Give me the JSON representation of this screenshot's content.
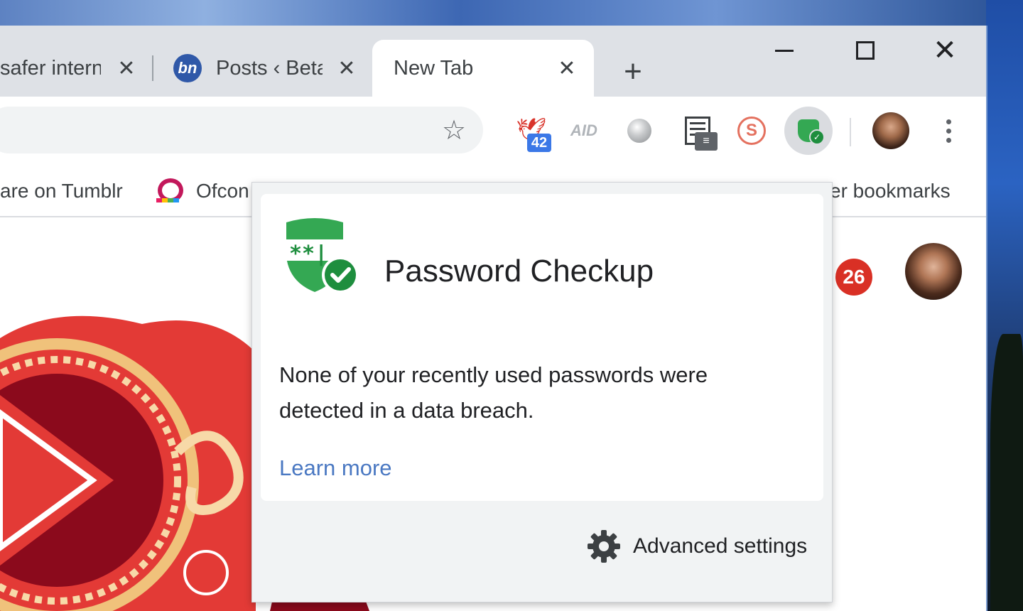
{
  "tabs": [
    {
      "title": "safer intern",
      "close": "✕"
    },
    {
      "title": "Posts ‹ Beta",
      "favicon_text": "bn",
      "close": "✕"
    },
    {
      "title": "New Tab",
      "close": "✕"
    }
  ],
  "newtab_symbol": "+",
  "window_controls": {
    "close_symbol": "✕"
  },
  "toolbar": {
    "star_symbol": "☆",
    "extensions": [
      {
        "name": "bird-extension",
        "badge": "42"
      },
      {
        "name": "aid-extension",
        "label": "AID"
      },
      {
        "name": "circle-extension"
      },
      {
        "name": "newspaper-extension",
        "badge": "≡"
      },
      {
        "name": "noscript-extension",
        "label": "S"
      },
      {
        "name": "password-checkup-extension"
      }
    ]
  },
  "bookmarks": [
    {
      "label": "are on Tumblr"
    },
    {
      "label": "Ofcon"
    },
    {
      "label": "er bookmarks"
    }
  ],
  "page": {
    "notification_count": "26"
  },
  "popup": {
    "title": "Password Checkup",
    "message": "None of your recently used passwords were detected in a data breach.",
    "link": "Learn more",
    "settings_label": "Advanced settings"
  },
  "colors": {
    "tabstrip": "#dee1e6",
    "shield_green": "#34a853",
    "check_green": "#1e8e3e",
    "link_blue": "#4a78c2",
    "badge_red": "#d93025",
    "doodle_red": "#e33a36"
  }
}
